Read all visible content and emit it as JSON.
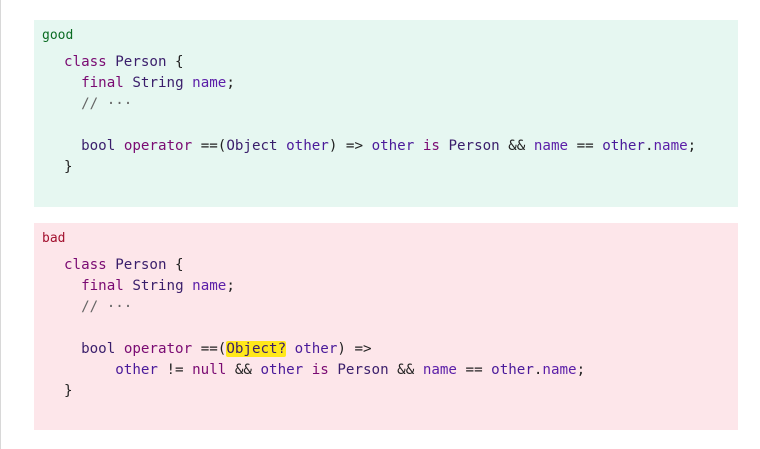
{
  "good": {
    "label": "good",
    "lines": [
      [
        {
          "t": "class",
          "c": "kw"
        },
        {
          "t": " "
        },
        {
          "t": "Person",
          "c": "ty"
        },
        {
          "t": " {"
        }
      ],
      [
        {
          "t": "  "
        },
        {
          "t": "final",
          "c": "kw"
        },
        {
          "t": " "
        },
        {
          "t": "String",
          "c": "ty"
        },
        {
          "t": " "
        },
        {
          "t": "name",
          "c": "prop"
        },
        {
          "t": ";"
        }
      ],
      [
        {
          "t": "  "
        },
        {
          "t": "// ···",
          "c": "cm"
        }
      ],
      [
        {
          "t": ""
        }
      ],
      [
        {
          "t": "  "
        },
        {
          "t": "bool",
          "c": "ty"
        },
        {
          "t": " "
        },
        {
          "t": "operator",
          "c": "kw"
        },
        {
          "t": " ==("
        },
        {
          "t": "Object",
          "c": "ty"
        },
        {
          "t": " "
        },
        {
          "t": "other",
          "c": "id"
        },
        {
          "t": ") => "
        },
        {
          "t": "other",
          "c": "id"
        },
        {
          "t": " "
        },
        {
          "t": "is",
          "c": "kw"
        },
        {
          "t": " "
        },
        {
          "t": "Person",
          "c": "ty"
        },
        {
          "t": " && "
        },
        {
          "t": "name",
          "c": "prop"
        },
        {
          "t": " == "
        },
        {
          "t": "other",
          "c": "id"
        },
        {
          "t": "."
        },
        {
          "t": "name",
          "c": "prop"
        },
        {
          "t": ";"
        }
      ],
      [
        {
          "t": "}"
        }
      ]
    ]
  },
  "bad": {
    "label": "bad",
    "lines": [
      [
        {
          "t": "class",
          "c": "kw"
        },
        {
          "t": " "
        },
        {
          "t": "Person",
          "c": "ty"
        },
        {
          "t": " {"
        }
      ],
      [
        {
          "t": "  "
        },
        {
          "t": "final",
          "c": "kw"
        },
        {
          "t": " "
        },
        {
          "t": "String",
          "c": "ty"
        },
        {
          "t": " "
        },
        {
          "t": "name",
          "c": "prop"
        },
        {
          "t": ";"
        }
      ],
      [
        {
          "t": "  "
        },
        {
          "t": "// ···",
          "c": "cm"
        }
      ],
      [
        {
          "t": ""
        }
      ],
      [
        {
          "t": "  "
        },
        {
          "t": "bool",
          "c": "ty"
        },
        {
          "t": " "
        },
        {
          "t": "operator",
          "c": "kw"
        },
        {
          "t": " ==("
        },
        {
          "t": "Object?",
          "c": "ty hl"
        },
        {
          "t": " "
        },
        {
          "t": "other",
          "c": "id"
        },
        {
          "t": ") =>"
        }
      ],
      [
        {
          "t": "      "
        },
        {
          "t": "other",
          "c": "id"
        },
        {
          "t": " != "
        },
        {
          "t": "null",
          "c": "kw"
        },
        {
          "t": " && "
        },
        {
          "t": "other",
          "c": "id"
        },
        {
          "t": " "
        },
        {
          "t": "is",
          "c": "kw"
        },
        {
          "t": " "
        },
        {
          "t": "Person",
          "c": "ty"
        },
        {
          "t": " && "
        },
        {
          "t": "name",
          "c": "prop"
        },
        {
          "t": " == "
        },
        {
          "t": "other",
          "c": "id"
        },
        {
          "t": "."
        },
        {
          "t": "name",
          "c": "prop"
        },
        {
          "t": ";"
        }
      ],
      [
        {
          "t": "}"
        }
      ]
    ]
  }
}
